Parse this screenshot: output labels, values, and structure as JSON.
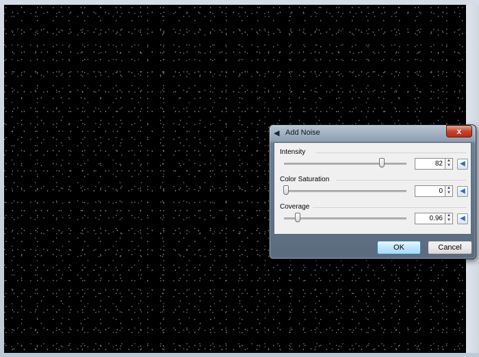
{
  "dialog": {
    "title": "Add Noise",
    "close_label": "x",
    "ok_label": "OK",
    "cancel_label": "Cancel"
  },
  "controls": [
    {
      "label": "Intensity",
      "value": "82",
      "slider_fraction": 0.82
    },
    {
      "label": "Color Saturation",
      "value": "0",
      "slider_fraction": 0.0
    },
    {
      "label": "Coverage",
      "value": "0.96",
      "slider_fraction": 0.1
    }
  ],
  "icons": {
    "title": "speaker-icon",
    "spin_up": "▲",
    "spin_down": "▼",
    "reset": "◀"
  }
}
